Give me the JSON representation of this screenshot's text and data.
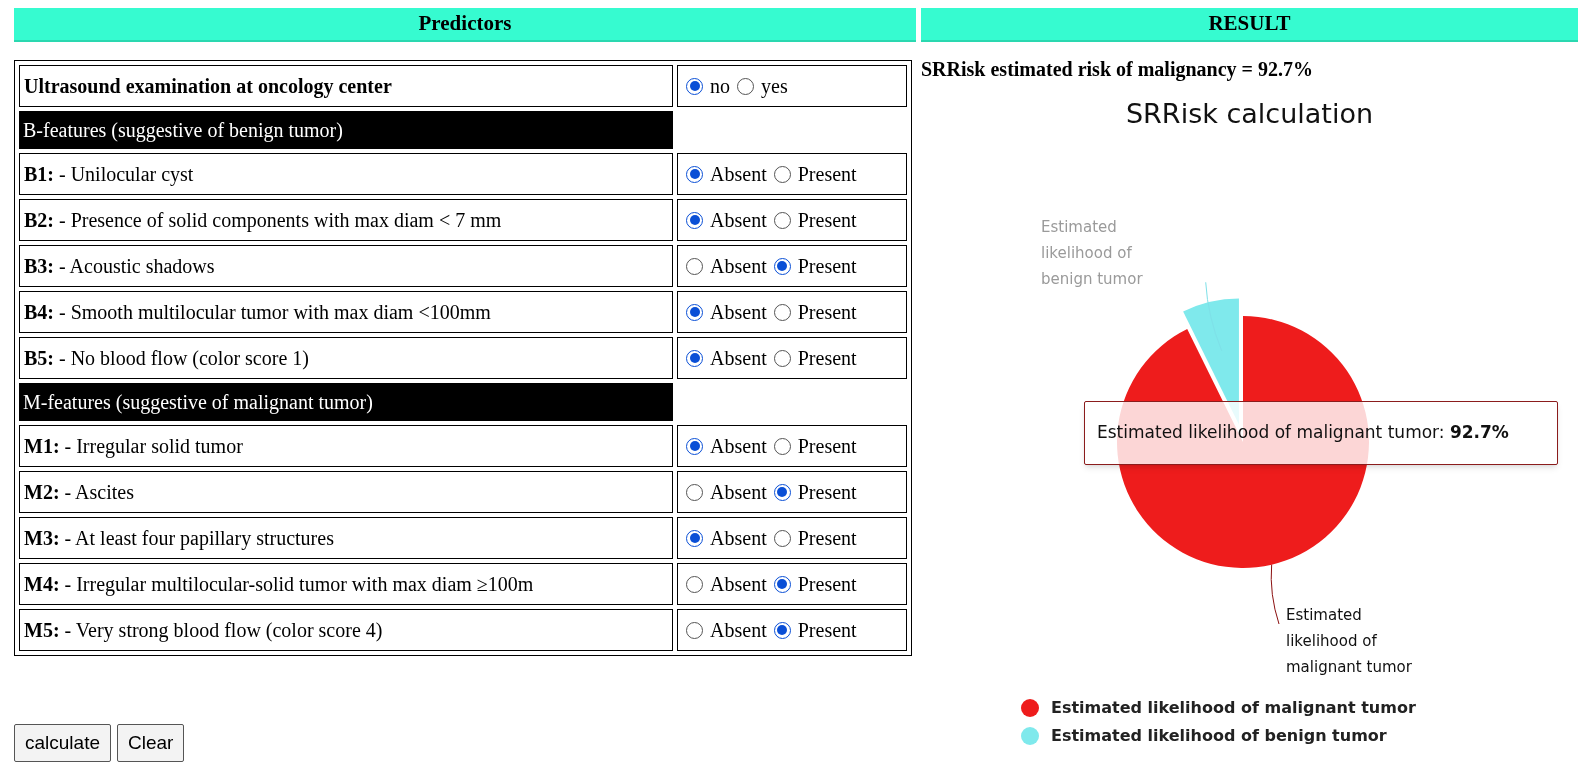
{
  "predictors_header": "Predictors",
  "result_header": "RESULT",
  "rows": [
    {
      "kind": "question",
      "label": "Ultrasound examination at oncology center",
      "options": [
        {
          "label": "no",
          "selected": true
        },
        {
          "label": "yes",
          "selected": false
        }
      ]
    },
    {
      "kind": "section",
      "label": "B-features (suggestive of benign tumor)"
    },
    {
      "kind": "feature",
      "code": "B1:",
      "label": "- Unilocular cyst",
      "options": [
        {
          "label": "Absent",
          "selected": true
        },
        {
          "label": "Present",
          "selected": false
        }
      ]
    },
    {
      "kind": "feature",
      "code": "B2:",
      "label": "- Presence of solid components with max diam < 7 mm",
      "options": [
        {
          "label": "Absent",
          "selected": true
        },
        {
          "label": "Present",
          "selected": false
        }
      ]
    },
    {
      "kind": "feature",
      "code": "B3:",
      "label": "- Acoustic shadows",
      "options": [
        {
          "label": "Absent",
          "selected": false
        },
        {
          "label": "Present",
          "selected": true
        }
      ]
    },
    {
      "kind": "feature",
      "code": "B4:",
      "label": "- Smooth multilocular tumor with max diam <100mm",
      "options": [
        {
          "label": "Absent",
          "selected": true
        },
        {
          "label": "Present",
          "selected": false
        }
      ]
    },
    {
      "kind": "feature",
      "code": "B5:",
      "label": "- No blood flow (color score 1)",
      "options": [
        {
          "label": "Absent",
          "selected": true
        },
        {
          "label": "Present",
          "selected": false
        }
      ]
    },
    {
      "kind": "section",
      "label": "M-features (suggestive of malignant tumor)"
    },
    {
      "kind": "feature",
      "code": "M1:",
      "label": "- Irregular solid tumor",
      "options": [
        {
          "label": "Absent",
          "selected": true
        },
        {
          "label": "Present",
          "selected": false
        }
      ]
    },
    {
      "kind": "feature",
      "code": "M2:",
      "label": "- Ascites",
      "options": [
        {
          "label": "Absent",
          "selected": false
        },
        {
          "label": "Present",
          "selected": true
        }
      ]
    },
    {
      "kind": "feature",
      "code": "M3:",
      "label": "- At least four papillary structures",
      "options": [
        {
          "label": "Absent",
          "selected": true
        },
        {
          "label": "Present",
          "selected": false
        }
      ]
    },
    {
      "kind": "feature",
      "code": "M4:",
      "label": "- Irregular multilocular-solid tumor with max diam ≥100m",
      "options": [
        {
          "label": "Absent",
          "selected": false
        },
        {
          "label": "Present",
          "selected": true
        }
      ]
    },
    {
      "kind": "feature",
      "code": "M5:",
      "label": "- Very strong blood flow (color score 4)",
      "options": [
        {
          "label": "Absent",
          "selected": false
        },
        {
          "label": "Present",
          "selected": true
        }
      ]
    }
  ],
  "buttons": [
    "calculate",
    "Clear"
  ],
  "result_text": "SRRisk estimated risk of malignancy = 92.7%",
  "chart": {
    "chart_data": {
      "type": "pie",
      "title": "SRRisk calculation",
      "categories": [
        "Estimated likelihood of malignant tumor",
        "Estimated likelihood of benign tumor"
      ],
      "values": [
        92.7,
        7.3
      ],
      "legend": "bottom"
    },
    "slice_labels": [
      {
        "text": "Estimated likelihood of malignant tumor",
        "exploded": false
      },
      {
        "text": "Estimated likelihood of benign tumor",
        "exploded": true
      }
    ],
    "tooltip": {
      "label": "Estimated likelihood of malignant tumor:",
      "value": "92.7%"
    },
    "legend": [
      {
        "color": "#ee1c1c"
      },
      {
        "color": "#7fe9ec"
      }
    ]
  }
}
